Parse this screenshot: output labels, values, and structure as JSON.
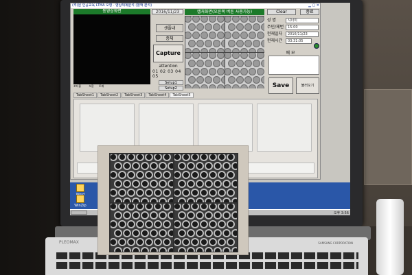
{
  "app": {
    "title": "(주)원 인공교육 LTMA 오영 · 영상체계분석 (혈액 분석)",
    "live_label": "동영상화면",
    "capture_label": "캡처화면(오른쪽 버튼 사용가능)",
    "date": "2016/11/23",
    "side_buttons": [
      "샌플내",
      "종체"
    ],
    "capture_button": "Capture",
    "attention_label": "attention",
    "attention_numbers": "01 02 03 04 05",
    "setup_buttons": [
      "Setup1",
      "Setup2"
    ],
    "clear_button": "Clear",
    "close_button": "종료",
    "fields": [
      {
        "label": "성 명",
        "value": "샤너이"
      },
      {
        "label": "주민/체번",
        "value": "15-00"
      },
      {
        "label": "현재일자",
        "value": "2016/11/23"
      },
      {
        "label": "현재시간",
        "value": "03:31:05"
      }
    ],
    "memo_label": "메 모",
    "save_button": "Save",
    "load_button": "불러오기",
    "tabs": [
      "TabSheet1",
      "TabSheet2",
      "TabSheet3",
      "TabSheet4",
      "TabSheet5"
    ],
    "active_tab": 4,
    "small_icons": [
      "포티블",
      "보합",
      "토패"
    ]
  },
  "desktop": {
    "icons": [
      "Word",
      "WinZip"
    ],
    "clock": "오후 3:56"
  },
  "keyboard": {
    "brand": "PLEOMAX",
    "corp": "SAMSUNG CORPORATION"
  },
  "colors": {
    "green_header": "#1c7a2a",
    "desktop_blue": "#2a57a8"
  }
}
